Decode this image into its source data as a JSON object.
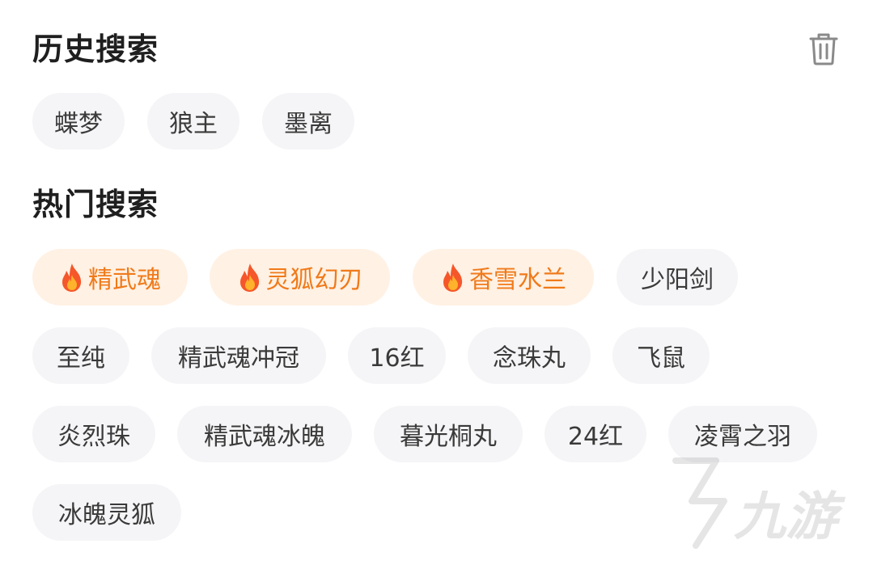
{
  "history": {
    "title": "历史搜索",
    "items": [
      {
        "label": "蝶梦"
      },
      {
        "label": "狼主"
      },
      {
        "label": "墨离"
      }
    ]
  },
  "hot": {
    "title": "热门搜索",
    "items": [
      {
        "label": "精武魂",
        "hot": true
      },
      {
        "label": "灵狐幻刃",
        "hot": true
      },
      {
        "label": "香雪水兰",
        "hot": true
      },
      {
        "label": "少阳剑"
      },
      {
        "label": "至纯"
      },
      {
        "label": "精武魂冲冠"
      },
      {
        "label": "16红"
      },
      {
        "label": "念珠丸"
      },
      {
        "label": "飞鼠"
      },
      {
        "label": "炎烈珠"
      },
      {
        "label": "精武魂冰魄"
      },
      {
        "label": "暮光桐丸"
      },
      {
        "label": "24红"
      },
      {
        "label": "凌霄之羽"
      },
      {
        "label": "冰魄灵狐"
      }
    ]
  },
  "icons": {
    "clear": "trash-icon",
    "hot_badge": "fire-icon"
  },
  "watermark": {
    "text": "九游"
  },
  "colors": {
    "hot_text": "#f07a1a",
    "hot_bg": "#fff1e4",
    "chip_bg": "#f5f5f7"
  }
}
